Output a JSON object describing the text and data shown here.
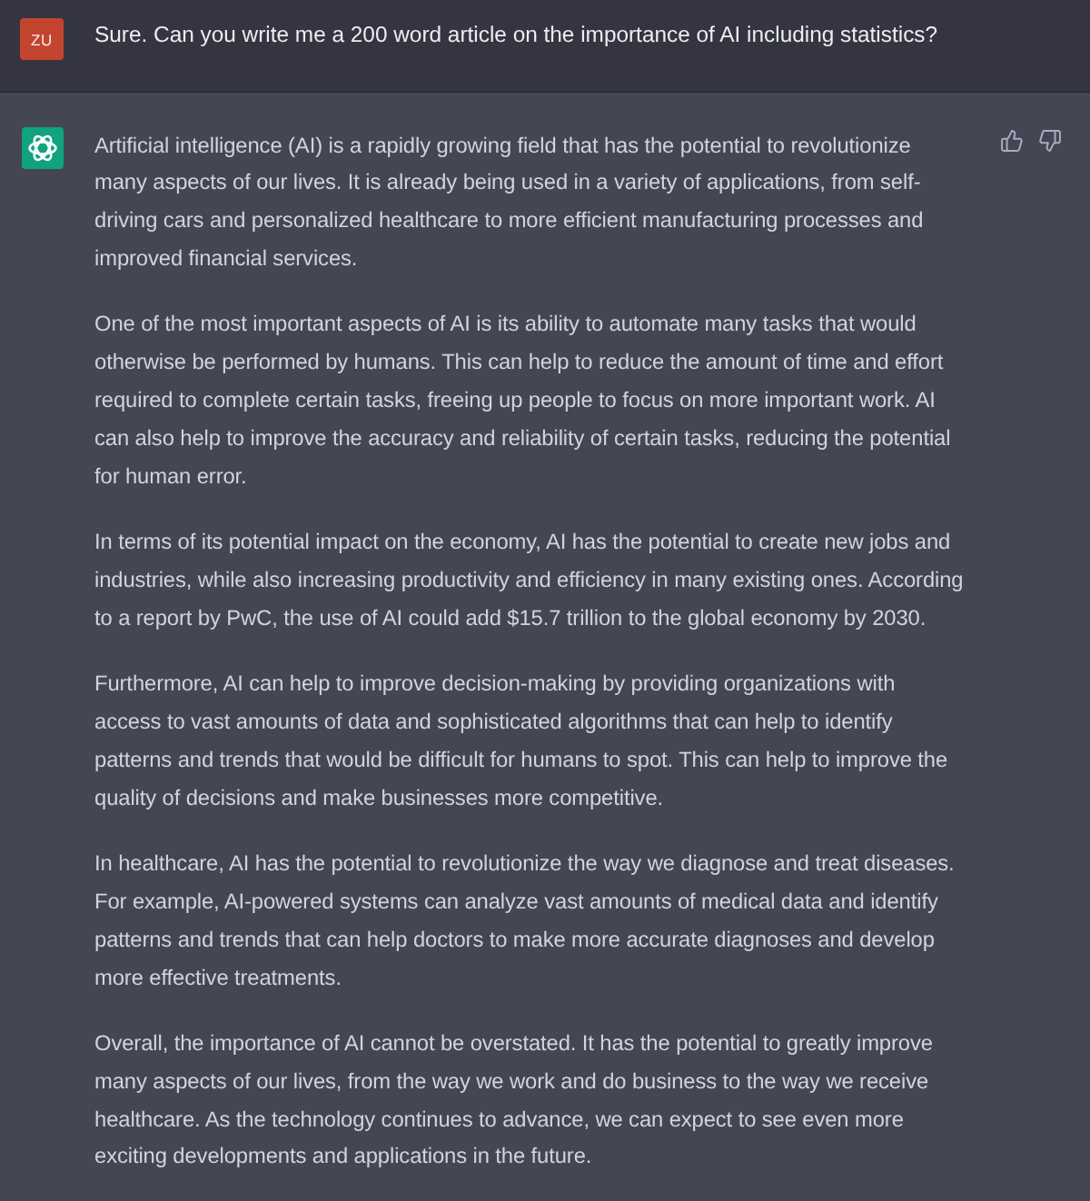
{
  "conversation": [
    {
      "kind": "user",
      "avatar": "ZU",
      "text": "Sure. Can you write me a 200 word article on the importance of AI including statistics?"
    },
    {
      "kind": "assistant",
      "paragraphs": [
        "Artificial intelligence (AI) is a rapidly growing field that has the potential to revolutionize\nmany aspects of our lives. It is already being used in a variety of applications, from self-\ndriving cars and personalized healthcare to more efficient manufacturing processes and\nimproved financial services.",
        "One of the most important aspects of AI is its ability to automate many tasks that would\notherwise be performed by humans. This can help to reduce the amount of time and effort\nrequired to complete certain tasks, freeing up people to focus on more important work. AI\ncan also help to improve the accuracy and reliability of certain tasks, reducing the potential\nfor human error.",
        "In terms of its potential impact on the economy, AI has the potential to create new jobs and\nindustries, while also increasing productivity and efficiency in many existing ones. According\nto a report by PwC, the use of AI could add $15.7 trillion to the global economy by 2030.",
        "Furthermore, AI can help to improve decision-making by providing organizations with\naccess to vast amounts of data and sophisticated algorithms that can help to identify\npatterns and trends that would be difficult for humans to spot. This can help to improve the\nquality of decisions and make businesses more competitive.",
        "In healthcare, AI has the potential to revolutionize the way we diagnose and treat diseases.\nFor example, AI-powered systems can analyze vast amounts of medical data and identify\npatterns and trends that can help doctors to make more accurate diagnoses and develop\nmore effective treatments.",
        "Overall, the importance of AI cannot be overstated. It has the potential to greatly improve\nmany aspects of our lives, from the way we work and do business to the way we receive\nhealthcare. As the technology continues to advance, we can expect to see even more\nexciting developments and applications in the future."
      ]
    }
  ]
}
